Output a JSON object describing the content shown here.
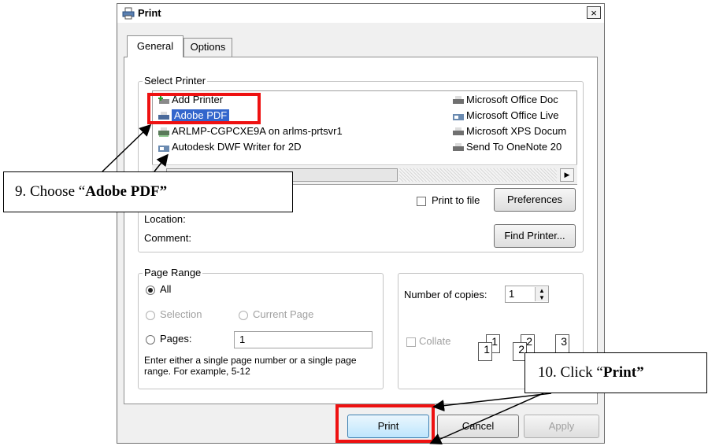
{
  "window": {
    "title": "Print",
    "close_label": "×"
  },
  "tabs": [
    {
      "label": "General",
      "active": true
    },
    {
      "label": "Options",
      "active": false
    }
  ],
  "select_printer": {
    "label": "Select Printer",
    "printers_left": [
      "Add Printer",
      "Adobe PDF",
      "ARLMP-CGPCXE9A on arlms-prtsvr1",
      "Autodesk DWF Writer for 2D"
    ],
    "printers_right": [
      "Microsoft Office Doc",
      "Microsoft Office Live",
      "Microsoft XPS Docum",
      "Send To OneNote 20"
    ],
    "selected": "Adobe PDF",
    "print_to_file_label": "Print to file",
    "preferences_label": "Preferences",
    "location_label": "Location:",
    "comment_label": "Comment:",
    "find_printer_label": "Find Printer..."
  },
  "page_range": {
    "label": "Page Range",
    "all_label": "All",
    "selection_label": "Selection",
    "current_page_label": "Current Page",
    "pages_label": "Pages:",
    "pages_value": "1",
    "hint": "Enter either a single page number or a single page range.  For example, 5-12",
    "selected_option": "All"
  },
  "copies": {
    "label": "Number of copies:",
    "value": "1",
    "collate_label": "Collate",
    "collate_icons": [
      "1",
      "1",
      "2",
      "2",
      "3"
    ]
  },
  "buttons": {
    "print": "Print",
    "cancel": "Cancel",
    "apply": "Apply"
  },
  "annotations": {
    "step9_prefix": "9. Choose “",
    "step9_bold": "Adobe PDF”",
    "step10_prefix": "10. Click “",
    "step10_bold": "Print”",
    "highlight_color": "#ee1111"
  },
  "colors": {
    "selection": "#3366cc",
    "dialog_bg": "#f0f0f0"
  }
}
